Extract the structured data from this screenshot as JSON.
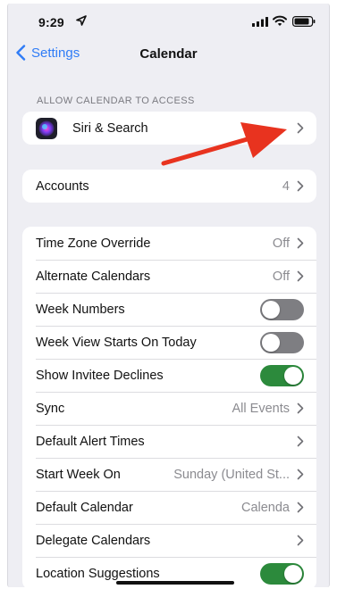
{
  "status_bar": {
    "time": "9:29"
  },
  "nav": {
    "back_label": "Settings",
    "title": "Calendar"
  },
  "access_section": {
    "header": "ALLOW CALENDAR TO ACCESS",
    "siri": {
      "label": "Siri & Search"
    }
  },
  "accounts": {
    "label": "Accounts",
    "value": "4"
  },
  "settings": {
    "time_zone_override": {
      "label": "Time Zone Override",
      "value": "Off"
    },
    "alternate_calendars": {
      "label": "Alternate Calendars",
      "value": "Off"
    },
    "week_numbers": {
      "label": "Week Numbers",
      "on": false
    },
    "week_view_starts_today": {
      "label": "Week View Starts On Today",
      "on": false
    },
    "show_invitee_declines": {
      "label": "Show Invitee Declines",
      "on": true
    },
    "sync": {
      "label": "Sync",
      "value": "All Events"
    },
    "default_alert_times": {
      "label": "Default Alert Times"
    },
    "start_week_on": {
      "label": "Start Week On",
      "value": "Sunday (United St..."
    },
    "default_calendar": {
      "label": "Default Calendar",
      "value": "Calenda"
    },
    "delegate_calendars": {
      "label": "Delegate Calendars"
    },
    "location_suggestions": {
      "label": "Location Suggestions",
      "on": true
    }
  },
  "colors": {
    "accent": "#2f7cf6",
    "toggle_on": "#2c8a3c",
    "toggle_off": "#7e7e82",
    "annotation_arrow": "#e8331f"
  },
  "icons": [
    "location-arrow-icon",
    "signal-icon",
    "wifi-icon",
    "battery-icon",
    "chevron-left-icon",
    "siri-icon",
    "chevron-right-icon",
    "annotation-arrow"
  ]
}
